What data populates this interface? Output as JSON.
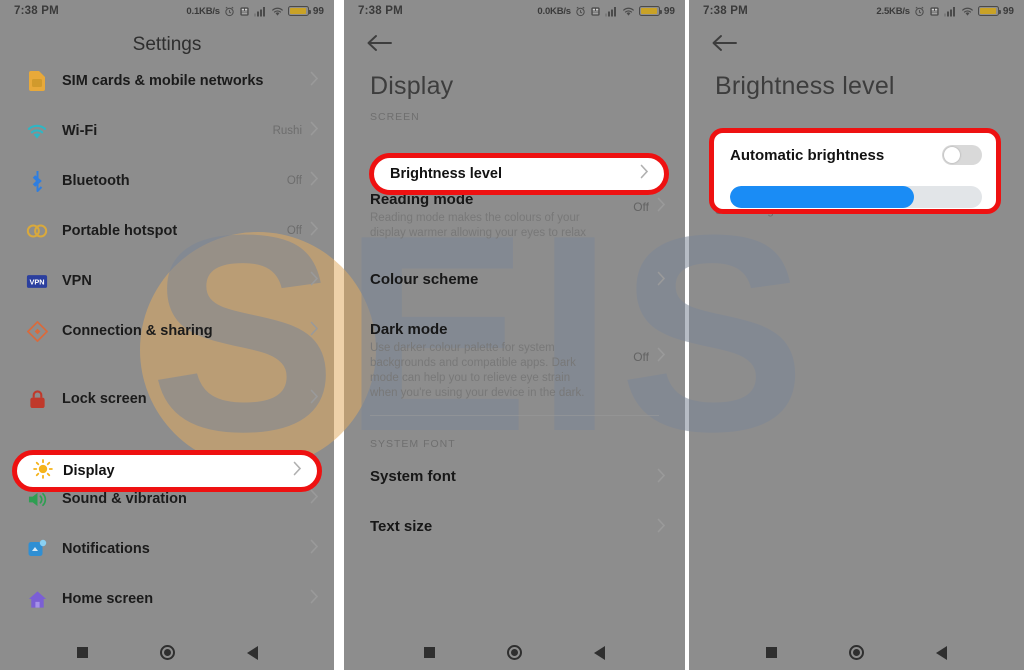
{
  "meta": {
    "accent_red": "#ee1111",
    "panel_bg": "#8d8d8d",
    "slider_blue": "#1a8cf5",
    "watermark_text": "SEIS"
  },
  "status_bar": {
    "panel1": {
      "time": "7:38 PM",
      "net_speed": "0.1KB/s",
      "battery_pct": "99"
    },
    "panel2": {
      "time": "7:38 PM",
      "net_speed": "0.0KB/s",
      "battery_pct": "99"
    },
    "panel3": {
      "time": "7:38 PM",
      "net_speed": "2.5KB/s",
      "battery_pct": "99"
    }
  },
  "panel_settings": {
    "title": "Settings",
    "items": [
      {
        "label": "SIM cards & mobile networks",
        "value": "",
        "icon": "sim-card-icon",
        "color": "#e8a93a"
      },
      {
        "label": "Wi-Fi",
        "value": "Rushi",
        "icon": "wifi-icon",
        "color": "#2fb6c4"
      },
      {
        "label": "Bluetooth",
        "value": "Off",
        "icon": "bluetooth-icon",
        "color": "#2f7ee0"
      },
      {
        "label": "Portable hotspot",
        "value": "Off",
        "icon": "hotspot-icon",
        "color": "#d9a93c"
      },
      {
        "label": "VPN",
        "value": "",
        "icon": "vpn-icon",
        "color": "#2b3f9e"
      },
      {
        "label": "Connection & sharing",
        "value": "",
        "icon": "connection-sharing-icon",
        "color": "#d96a3c"
      },
      {
        "label": "Lock screen",
        "value": "",
        "icon": "lock-icon",
        "color": "#c0392b"
      },
      {
        "label": "Display",
        "value": "",
        "icon": "sun-icon",
        "color": "#f5b31a",
        "highlighted": true
      },
      {
        "label": "Sound & vibration",
        "value": "",
        "icon": "speaker-icon",
        "color": "#2e9e52"
      },
      {
        "label": "Notifications",
        "value": "",
        "icon": "notifications-icon",
        "color": "#2f8fd4"
      },
      {
        "label": "Home screen",
        "value": "",
        "icon": "home-icon",
        "color": "#7b5fd4"
      }
    ],
    "highlight": {
      "label": "Display"
    }
  },
  "panel_display": {
    "title": "Display",
    "section_screen": "SCREEN",
    "section_system_font": "SYSTEM FONT",
    "highlight": {
      "label": "Brightness level"
    },
    "items": [
      {
        "label": "Reading mode",
        "sub": "Reading mode makes the colours of your display warmer allowing your eyes to relax",
        "value": "Off"
      },
      {
        "label": "Colour scheme",
        "sub": "",
        "value": ""
      },
      {
        "label": "Dark mode",
        "sub": "Use darker colour palette for system backgrounds and compatible apps. Dark mode can help you to relieve eye strain when you're using your device in the dark.",
        "value": "Off"
      }
    ],
    "font_items": [
      {
        "label": "System font",
        "value": ""
      },
      {
        "label": "Text size",
        "value": ""
      }
    ]
  },
  "panel_brightness": {
    "title": "Brightness level",
    "auto_label": "Automatic brightness",
    "auto_state": "off",
    "slider_percent": 73,
    "hint": "Screen brightness will remain constant."
  },
  "nav_bar": {
    "recents": "recents-square-icon",
    "home": "home-circle-icon",
    "back": "back-triangle-icon"
  }
}
